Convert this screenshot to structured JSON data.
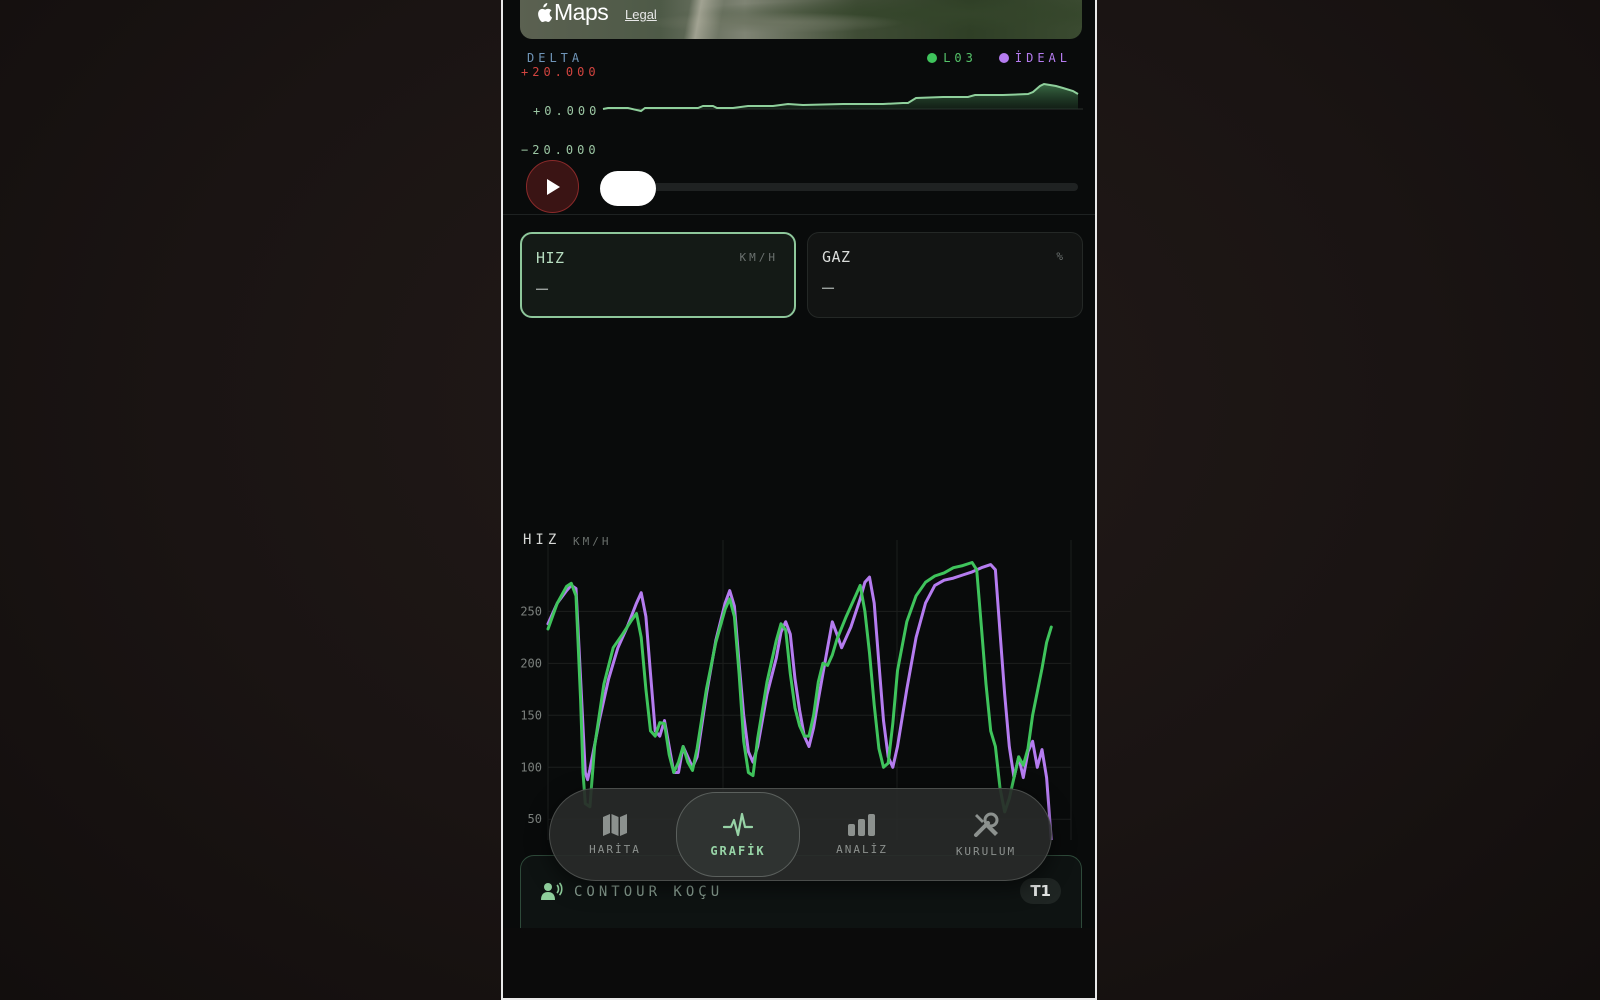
{
  "map": {
    "logo_text": "Maps",
    "legal_link": "Legal"
  },
  "delta": {
    "title": "DELTA",
    "upper_label": "+20.000",
    "zero_label": "+0.000",
    "lower_label": "−20.000",
    "legend": [
      {
        "name": "L03",
        "color": "#3fc45c"
      },
      {
        "name": "İDEAL",
        "color": "#b57cf0"
      }
    ]
  },
  "playback": {
    "progress": 0.0
  },
  "metric_cards": [
    {
      "label": "HIZ",
      "unit": "KM/H",
      "value": "—",
      "active": true
    },
    {
      "label": "GAZ",
      "unit": "%",
      "value": "—",
      "active": false
    }
  ],
  "speed_chart": {
    "title": "HIZ",
    "unit": "KM/H",
    "y_ticks": [
      "250",
      "200",
      "150",
      "100",
      "50"
    ]
  },
  "chart_data": {
    "type": "line",
    "title": "HIZ",
    "ylabel": "KM/H",
    "ylim": [
      30,
      285
    ],
    "xlim": [
      0,
      100
    ],
    "series": [
      {
        "name": "L03",
        "color": "#3fc45c",
        "points": [
          [
            0,
            233
          ],
          [
            2,
            258
          ],
          [
            4,
            274
          ],
          [
            5,
            277
          ],
          [
            6,
            265
          ],
          [
            7,
            165
          ],
          [
            7.5,
            95
          ],
          [
            8,
            65
          ],
          [
            9,
            62
          ],
          [
            10,
            120
          ],
          [
            12,
            180
          ],
          [
            14,
            215
          ],
          [
            16,
            228
          ],
          [
            18,
            242
          ],
          [
            19,
            248
          ],
          [
            20,
            225
          ],
          [
            21,
            175
          ],
          [
            22,
            135
          ],
          [
            23,
            130
          ],
          [
            24,
            143
          ],
          [
            25,
            142
          ],
          [
            26,
            112
          ],
          [
            27,
            95
          ],
          [
            28,
            105
          ],
          [
            29,
            120
          ],
          [
            30,
            105
          ],
          [
            31,
            97
          ],
          [
            32,
            118
          ],
          [
            34,
            175
          ],
          [
            36,
            220
          ],
          [
            38,
            252
          ],
          [
            39,
            262
          ],
          [
            40,
            245
          ],
          [
            41,
            190
          ],
          [
            42,
            125
          ],
          [
            43,
            95
          ],
          [
            44,
            92
          ],
          [
            45,
            128
          ],
          [
            47,
            182
          ],
          [
            49,
            222
          ],
          [
            50,
            238
          ],
          [
            51,
            232
          ],
          [
            52,
            190
          ],
          [
            53,
            157
          ],
          [
            54,
            140
          ],
          [
            55,
            130
          ],
          [
            56,
            130
          ],
          [
            57,
            150
          ],
          [
            58,
            182
          ],
          [
            59,
            200
          ],
          [
            60,
            198
          ],
          [
            61,
            208
          ],
          [
            62,
            223
          ],
          [
            64,
            245
          ],
          [
            66,
            265
          ],
          [
            67,
            275
          ],
          [
            68,
            250
          ],
          [
            69,
            210
          ],
          [
            70,
            160
          ],
          [
            71,
            118
          ],
          [
            72,
            100
          ],
          [
            73,
            104
          ],
          [
            74,
            142
          ],
          [
            75,
            193
          ],
          [
            77,
            240
          ],
          [
            79,
            265
          ],
          [
            81,
            278
          ],
          [
            83,
            284
          ],
          [
            85,
            287
          ],
          [
            87,
            292
          ],
          [
            89,
            294
          ],
          [
            91,
            297
          ],
          [
            92,
            290
          ],
          [
            93,
            235
          ],
          [
            94,
            180
          ],
          [
            95,
            135
          ],
          [
            96,
            120
          ],
          [
            97,
            80
          ],
          [
            98,
            57
          ],
          [
            99,
            70
          ],
          [
            100,
            90
          ],
          [
            101,
            110
          ],
          [
            102,
            102
          ],
          [
            103,
            118
          ],
          [
            104,
            150
          ],
          [
            106,
            195
          ],
          [
            107,
            220
          ],
          [
            108,
            235
          ]
        ]
      },
      {
        "name": "İDEAL",
        "color": "#b57cf0",
        "points": [
          [
            0,
            238
          ],
          [
            2,
            258
          ],
          [
            4,
            270
          ],
          [
            5,
            275
          ],
          [
            6,
            272
          ],
          [
            7,
            185
          ],
          [
            8,
            95
          ],
          [
            8.5,
            88
          ],
          [
            9,
            98
          ],
          [
            11,
            145
          ],
          [
            13,
            185
          ],
          [
            15,
            215
          ],
          [
            17,
            235
          ],
          [
            19,
            258
          ],
          [
            20,
            268
          ],
          [
            21,
            245
          ],
          [
            22,
            190
          ],
          [
            23,
            135
          ],
          [
            24,
            130
          ],
          [
            25,
            145
          ],
          [
            27,
            95
          ],
          [
            28,
            95
          ],
          [
            29,
            120
          ],
          [
            31,
            100
          ],
          [
            32,
            110
          ],
          [
            34,
            170
          ],
          [
            36,
            222
          ],
          [
            38,
            258
          ],
          [
            39,
            270
          ],
          [
            40,
            255
          ],
          [
            41,
            200
          ],
          [
            42,
            150
          ],
          [
            43,
            115
          ],
          [
            44,
            105
          ],
          [
            45,
            120
          ],
          [
            47,
            170
          ],
          [
            49,
            205
          ],
          [
            50,
            230
          ],
          [
            51,
            240
          ],
          [
            52,
            228
          ],
          [
            53,
            185
          ],
          [
            54,
            155
          ],
          [
            55,
            130
          ],
          [
            56,
            120
          ],
          [
            57,
            138
          ],
          [
            58,
            165
          ],
          [
            59,
            190
          ],
          [
            60,
            215
          ],
          [
            61,
            240
          ],
          [
            62,
            228
          ],
          [
            63,
            215
          ],
          [
            65,
            235
          ],
          [
            67,
            262
          ],
          [
            68,
            278
          ],
          [
            69,
            283
          ],
          [
            70,
            258
          ],
          [
            71,
            200
          ],
          [
            72,
            145
          ],
          [
            73,
            110
          ],
          [
            74,
            100
          ],
          [
            75,
            120
          ],
          [
            77,
            175
          ],
          [
            79,
            225
          ],
          [
            81,
            258
          ],
          [
            83,
            275
          ],
          [
            85,
            280
          ],
          [
            87,
            282
          ],
          [
            89,
            285
          ],
          [
            91,
            288
          ],
          [
            93,
            292
          ],
          [
            95,
            295
          ],
          [
            96,
            290
          ],
          [
            97,
            230
          ],
          [
            98,
            170
          ],
          [
            99,
            120
          ],
          [
            100,
            90
          ],
          [
            101,
            110
          ],
          [
            102,
            90
          ],
          [
            103,
            115
          ],
          [
            104,
            125
          ],
          [
            105,
            100
          ],
          [
            106,
            117
          ],
          [
            107,
            90
          ],
          [
            108,
            30
          ]
        ]
      }
    ]
  },
  "nav": {
    "items": [
      {
        "label": "HARİTA",
        "icon": "map-icon",
        "active": false
      },
      {
        "label": "GRAFİK",
        "icon": "pulse-icon",
        "active": true
      },
      {
        "label": "ANALİZ",
        "icon": "bar-chart-icon",
        "active": false
      },
      {
        "label": "KURULUM",
        "icon": "tools-icon",
        "active": false
      }
    ]
  },
  "coach": {
    "title": "CONTOUR KOÇU",
    "badge": "T1"
  },
  "colors": {
    "accent_green": "#3fc45c",
    "ideal_purple": "#b57cf0",
    "delta_red": "#d2443f",
    "delta_blue": "#6f95b8"
  }
}
